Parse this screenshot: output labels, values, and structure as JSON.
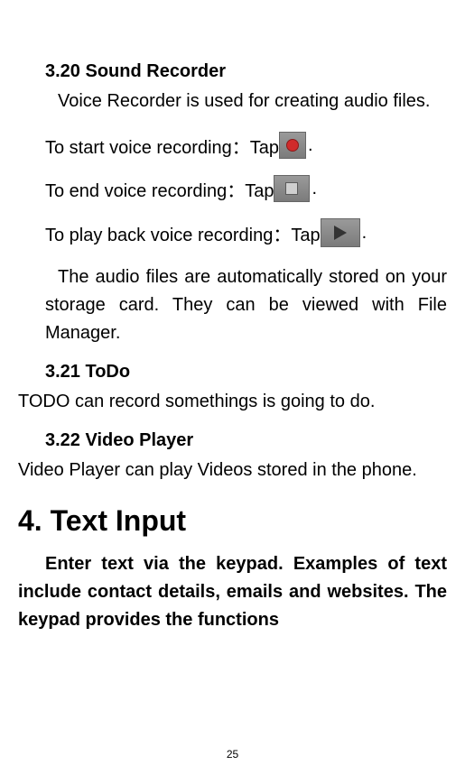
{
  "sections": {
    "s320": {
      "heading": "3.20    Sound Recorder",
      "intro": "Voice Recorder is used for creating audio files.",
      "startLine": {
        "before": "To start voice recording：Tap",
        "after": "."
      },
      "endLine": {
        "before": "To end voice recording：Tap",
        "after": "."
      },
      "playLine": {
        "before": "To play back voice recording：Tap",
        "after": "."
      },
      "storage": "The audio files are automatically stored on your   storage card. They can be viewed with File Manager."
    },
    "s321": {
      "heading": "3.21    ToDo",
      "body": "TODO can record somethings is going to do."
    },
    "s322": {
      "heading": "3.22    Video Player",
      "body": "Video Player can play Videos stored in the phone."
    },
    "chapter4": {
      "title": "4. Text Input",
      "body": "Enter text via the keypad. Examples of text include contact details, emails and websites. The keypad provides the functions"
    }
  },
  "pageNumber": "25"
}
